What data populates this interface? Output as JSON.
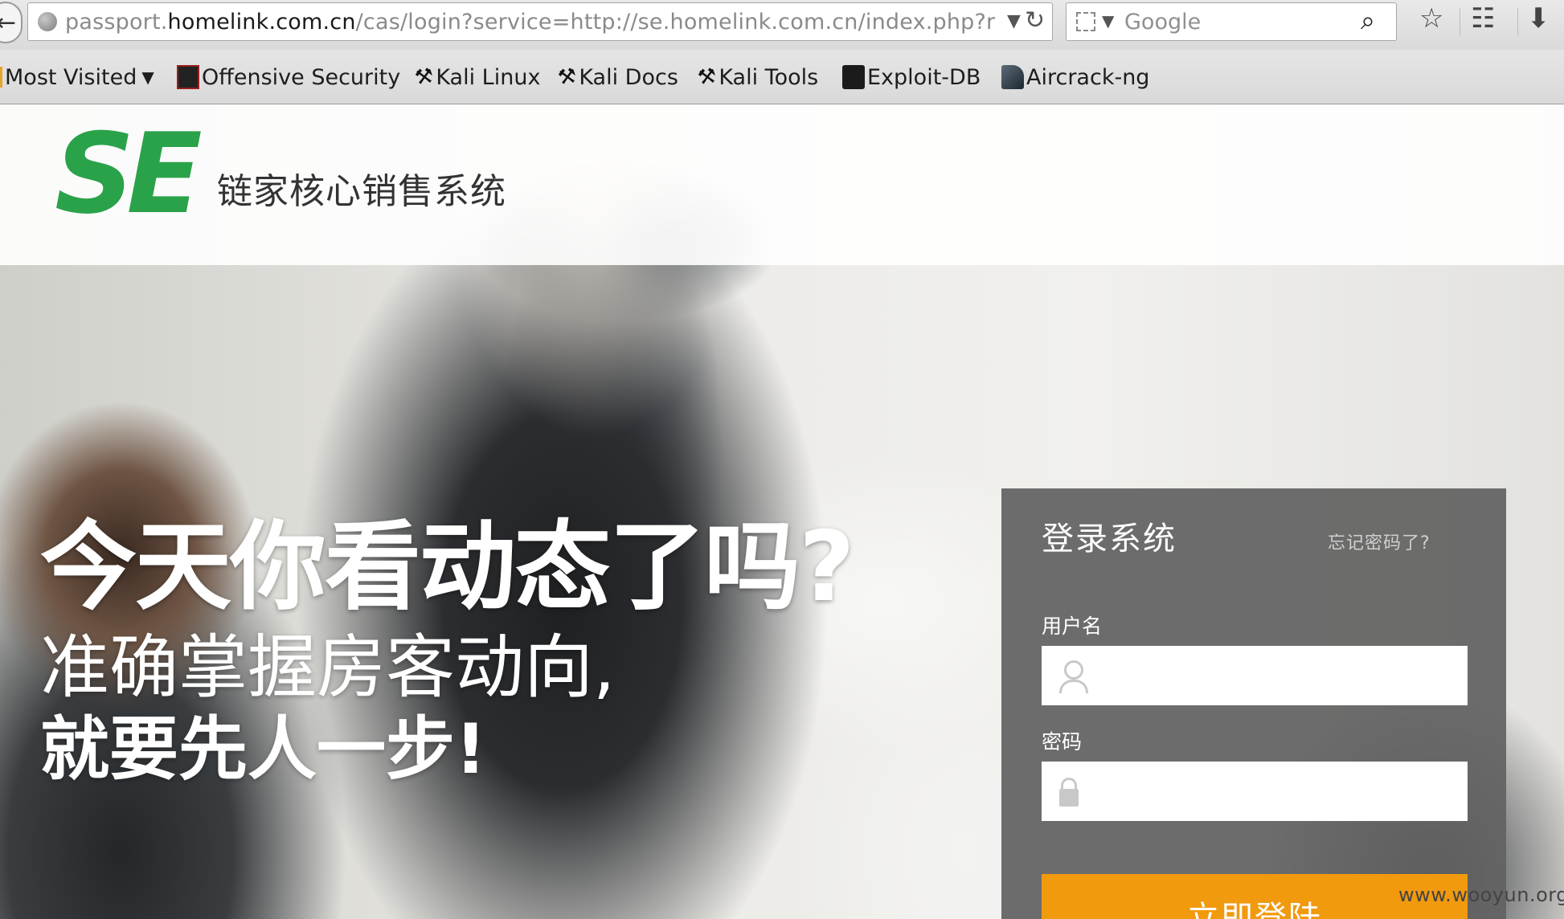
{
  "browser": {
    "url_host": "passport.",
    "url_domain": "homelink.com.cn",
    "url_path": "/cas/login?service=http://se.homelink.com.cn/index.php?r=publ",
    "search_placeholder": "Google",
    "bookmarks": [
      {
        "label": "Most Visited",
        "icon": "folder-icon"
      },
      {
        "label": "Offensive Security",
        "icon": "offsec-icon"
      },
      {
        "label": "Kali Linux",
        "icon": "kali-dragon-icon"
      },
      {
        "label": "Kali Docs",
        "icon": "kali-dragon-icon"
      },
      {
        "label": "Kali Tools",
        "icon": "kali-dragon-icon"
      },
      {
        "label": "Exploit-DB",
        "icon": "exploit-db-icon"
      },
      {
        "label": "Aircrack-ng",
        "icon": "aircrack-icon"
      }
    ]
  },
  "header": {
    "logo": "SE",
    "system_name": "链家核心销售系统"
  },
  "hero": {
    "line1": "今天你看动态了吗?",
    "line2": "准确掌握房客动向,",
    "line3": "就要先人一步!"
  },
  "login": {
    "title": "登录系统",
    "forgot": "忘记密码了?",
    "username_label": "用户名",
    "password_label": "密码",
    "submit": "立即登陆"
  },
  "watermark": "www.wooyun.org",
  "colors": {
    "brand_green": "#2aa24a",
    "button_orange": "#f19a0e",
    "panel_gray": "#626262"
  }
}
